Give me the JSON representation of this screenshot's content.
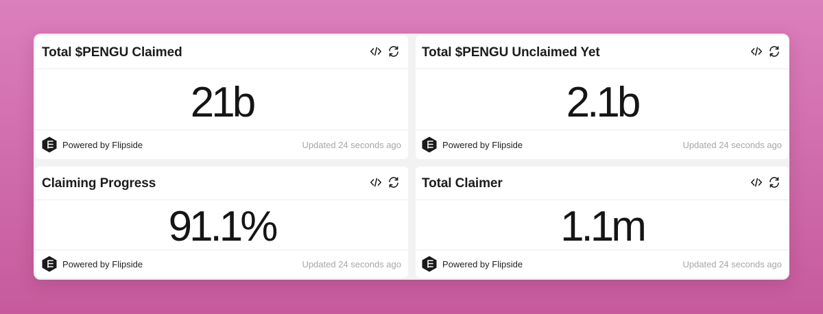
{
  "cards": [
    {
      "title": "Total $PENGU Claimed",
      "value": "21b",
      "powered_by": "Powered by Flipside",
      "updated": "Updated 24 seconds ago"
    },
    {
      "title": "Total $PENGU Unclaimed Yet",
      "value": "2.1b",
      "powered_by": "Powered by Flipside",
      "updated": "Updated 24 seconds ago"
    },
    {
      "title": "Claiming Progress",
      "value": "91.1%",
      "powered_by": "Powered by Flipside",
      "updated": "Updated 24 seconds ago"
    },
    {
      "title": "Total Claimer",
      "value": "1.1m",
      "powered_by": "Powered by Flipside",
      "updated": "Updated 24 seconds ago"
    }
  ],
  "icons": {
    "embed": "code-icon",
    "refresh": "refresh-icon",
    "logo": "flipside-logo-icon"
  },
  "colors": {
    "background_top": "#db7fbc",
    "background_bottom": "#c65a9c",
    "card": "#ffffff",
    "text": "#151515",
    "muted": "#a6a6a6"
  }
}
